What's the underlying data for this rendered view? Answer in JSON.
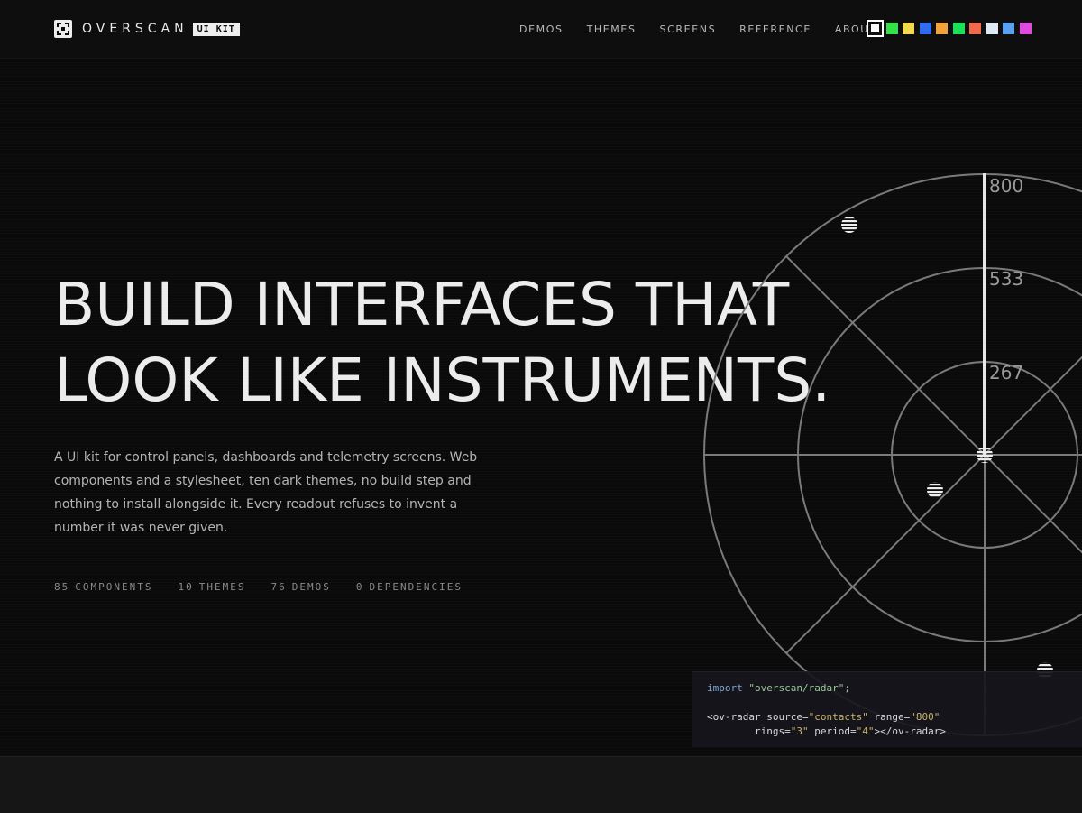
{
  "header": {
    "brand": "OVERSCAN",
    "badge": "UI KIT",
    "nav": [
      "DEMOS",
      "THEMES",
      "SCREENS",
      "REFERENCE",
      "ABOUT"
    ],
    "swatches": [
      "#ffffff",
      "#35e04a",
      "#f2d94e",
      "#2f6cf0",
      "#f2a23a",
      "#1ae05a",
      "#ef6a4a",
      "#dfe9f3",
      "#5aa0f2",
      "#e04ae0"
    ]
  },
  "hero": {
    "title_line1": "BUILD INTERFACES THAT",
    "title_line2": "LOOK LIKE INSTRUMENTS.",
    "description": "A UI kit for control panels, dashboards and telemetry screens. Web components and a stylesheet, ten dark themes, no build step and nothing to install alongside it. Every readout refuses to invent a number it was never given.",
    "stats": [
      {
        "num": "85",
        "label": "COMPONENTS"
      },
      {
        "num": "10",
        "label": "THEMES"
      },
      {
        "num": "76",
        "label": "DEMOS"
      },
      {
        "num": "0",
        "label": "DEPENDENCIES"
      }
    ]
  },
  "radar": {
    "range_labels": [
      "800",
      "533",
      "267"
    ]
  },
  "code": {
    "line1_kw": "import",
    "line1_str": "\"overscan/radar\";",
    "line2_open": "<ov-radar",
    "line2_attr1": "source=",
    "line2_val1": "\"contacts\"",
    "line2_attr2": "range=",
    "line2_val2": "\"800\"",
    "line3_attr1": "rings=",
    "line3_val1": "\"3\"",
    "line3_attr2": "period=",
    "line3_val2": "\"4\"",
    "line3_close": "></ov-radar>"
  }
}
